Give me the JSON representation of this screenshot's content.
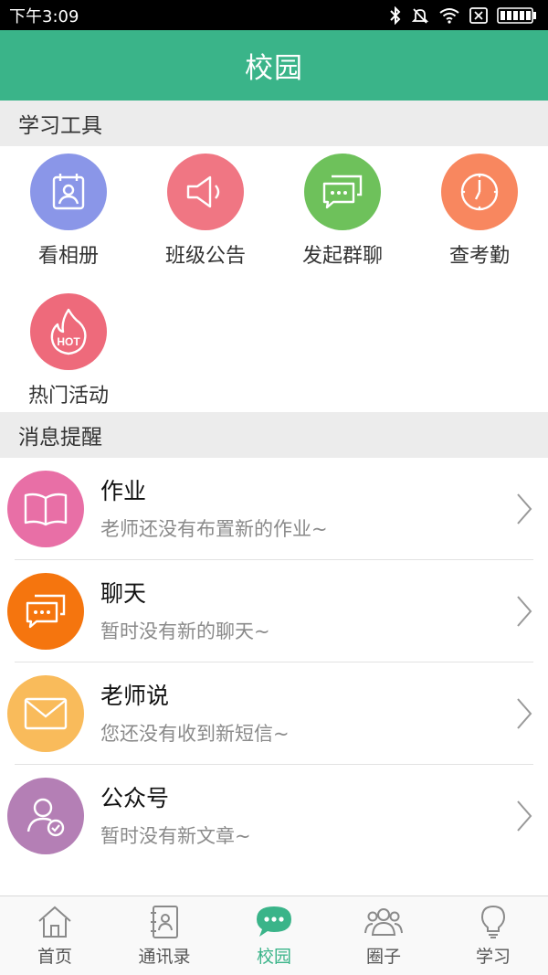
{
  "status_bar": {
    "time": "下午3:09"
  },
  "header": {
    "title": "校园"
  },
  "sections": {
    "tools": "学习工具",
    "messages": "消息提醒"
  },
  "tools": [
    {
      "label": "看相册",
      "icon": "photo-album-icon",
      "color": "#8a96e8"
    },
    {
      "label": "班级公告",
      "icon": "megaphone-icon",
      "color": "#f07683"
    },
    {
      "label": "发起群聊",
      "icon": "chat-bubbles-icon",
      "color": "#6ec15b"
    },
    {
      "label": "查考勤",
      "icon": "clock-icon",
      "color": "#f8875f"
    },
    {
      "label": "热门活动",
      "icon": "hot-flame-icon",
      "color": "#ee6a7b",
      "badge": "HOT"
    }
  ],
  "messages": [
    {
      "title": "作业",
      "subtitle": "老师还没有布置新的作业~",
      "icon": "book-icon",
      "color": "#e86fa6"
    },
    {
      "title": "聊天",
      "subtitle": "暂时没有新的聊天~",
      "icon": "chat-bubbles-icon",
      "color": "#f5750e"
    },
    {
      "title": "老师说",
      "subtitle": "您还没有收到新短信~",
      "icon": "envelope-icon",
      "color": "#f9bb5b"
    },
    {
      "title": "公众号",
      "subtitle": "暂时没有新文章~",
      "icon": "user-check-icon",
      "color": "#b47fb5"
    }
  ],
  "tabs": [
    {
      "label": "首页",
      "icon": "home-icon",
      "active": false
    },
    {
      "label": "通讯录",
      "icon": "contacts-book-icon",
      "active": false
    },
    {
      "label": "校园",
      "icon": "chat-bubble-icon",
      "active": true
    },
    {
      "label": "圈子",
      "icon": "group-icon",
      "active": false
    },
    {
      "label": "学习",
      "icon": "lightbulb-icon",
      "active": false
    }
  ],
  "colors": {
    "accent": "#3ab489",
    "section_bg": "#ececec"
  }
}
